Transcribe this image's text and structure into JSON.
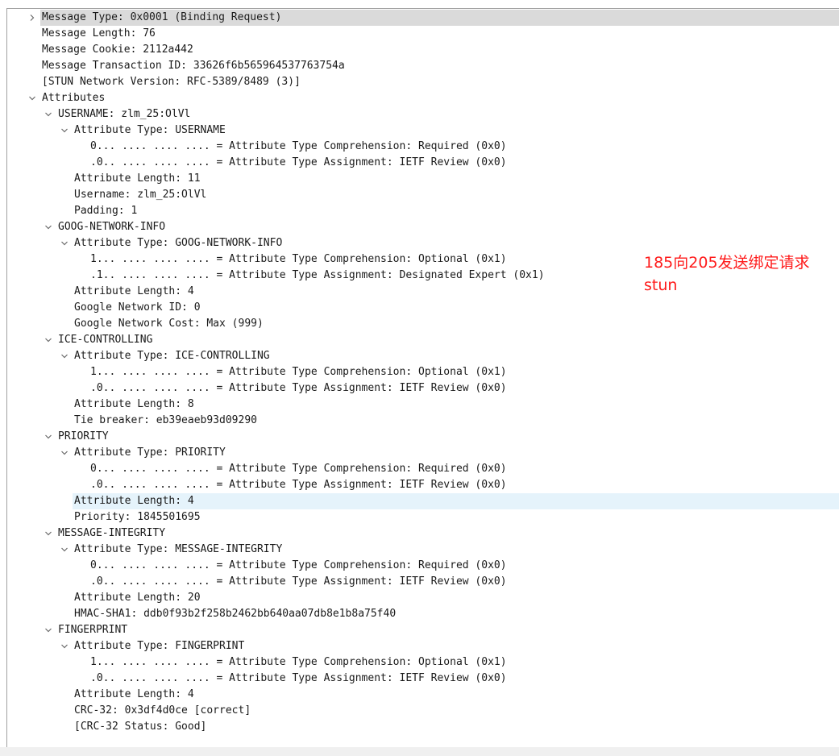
{
  "tree": [
    {
      "text": "Message Type: 0x0001 (Binding Request)",
      "level": 0,
      "toggle": "collapsed",
      "state": "selected",
      "name": "tree-item-message-type"
    },
    {
      "text": "Message Length: 76",
      "level": 0,
      "toggle": "none",
      "name": "tree-item-message-length"
    },
    {
      "text": "Message Cookie: 2112a442",
      "level": 0,
      "toggle": "none",
      "name": "tree-item-message-cookie"
    },
    {
      "text": "Message Transaction ID: 33626f6b565964537763754a",
      "level": 0,
      "toggle": "none",
      "name": "tree-item-transaction-id"
    },
    {
      "text": "[STUN Network Version: RFC-5389/8489 (3)]",
      "level": 0,
      "toggle": "none",
      "name": "tree-item-stun-network-version"
    },
    {
      "text": "Attributes",
      "level": 0,
      "toggle": "expanded",
      "name": "tree-item-attributes"
    },
    {
      "text": "USERNAME: zlm_25:OlVl",
      "level": 1,
      "toggle": "expanded",
      "name": "tree-item-attr-username"
    },
    {
      "text": "Attribute Type: USERNAME",
      "level": 2,
      "toggle": "expanded",
      "name": "tree-item-attribute-type"
    },
    {
      "text": "0... .... .... .... = Attribute Type Comprehension: Required (0x0)",
      "level": 3,
      "toggle": "none",
      "name": "tree-item-type-comprehension"
    },
    {
      "text": ".0.. .... .... .... = Attribute Type Assignment: IETF Review (0x0)",
      "level": 3,
      "toggle": "none",
      "name": "tree-item-type-assignment"
    },
    {
      "text": "Attribute Length: 11",
      "level": 2,
      "toggle": "none",
      "name": "tree-item-attribute-length"
    },
    {
      "text": "Username: zlm_25:OlVl",
      "level": 2,
      "toggle": "none",
      "name": "tree-item-username"
    },
    {
      "text": "Padding: 1",
      "level": 2,
      "toggle": "none",
      "name": "tree-item-padding"
    },
    {
      "text": "GOOG-NETWORK-INFO",
      "level": 1,
      "toggle": "expanded",
      "name": "tree-item-attr-goog-network-info"
    },
    {
      "text": "Attribute Type: GOOG-NETWORK-INFO",
      "level": 2,
      "toggle": "expanded",
      "name": "tree-item-attribute-type"
    },
    {
      "text": "1... .... .... .... = Attribute Type Comprehension: Optional (0x1)",
      "level": 3,
      "toggle": "none",
      "name": "tree-item-type-comprehension"
    },
    {
      "text": ".1.. .... .... .... = Attribute Type Assignment: Designated Expert (0x1)",
      "level": 3,
      "toggle": "none",
      "name": "tree-item-type-assignment"
    },
    {
      "text": "Attribute Length: 4",
      "level": 2,
      "toggle": "none",
      "name": "tree-item-attribute-length"
    },
    {
      "text": "Google Network ID: 0",
      "level": 2,
      "toggle": "none",
      "name": "tree-item-google-network-id"
    },
    {
      "text": "Google Network Cost: Max (999)",
      "level": 2,
      "toggle": "none",
      "name": "tree-item-google-network-cost"
    },
    {
      "text": "ICE-CONTROLLING",
      "level": 1,
      "toggle": "expanded",
      "name": "tree-item-attr-ice-controlling"
    },
    {
      "text": "Attribute Type: ICE-CONTROLLING",
      "level": 2,
      "toggle": "expanded",
      "name": "tree-item-attribute-type"
    },
    {
      "text": "1... .... .... .... = Attribute Type Comprehension: Optional (0x1)",
      "level": 3,
      "toggle": "none",
      "name": "tree-item-type-comprehension"
    },
    {
      "text": ".0.. .... .... .... = Attribute Type Assignment: IETF Review (0x0)",
      "level": 3,
      "toggle": "none",
      "name": "tree-item-type-assignment"
    },
    {
      "text": "Attribute Length: 8",
      "level": 2,
      "toggle": "none",
      "name": "tree-item-attribute-length"
    },
    {
      "text": "Tie breaker: eb39eaeb93d09290",
      "level": 2,
      "toggle": "none",
      "name": "tree-item-tie-breaker"
    },
    {
      "text": "PRIORITY",
      "level": 1,
      "toggle": "expanded",
      "name": "tree-item-attr-priority"
    },
    {
      "text": "Attribute Type: PRIORITY",
      "level": 2,
      "toggle": "expanded",
      "name": "tree-item-attribute-type"
    },
    {
      "text": "0... .... .... .... = Attribute Type Comprehension: Required (0x0)",
      "level": 3,
      "toggle": "none",
      "name": "tree-item-type-comprehension"
    },
    {
      "text": ".0.. .... .... .... = Attribute Type Assignment: IETF Review (0x0)",
      "level": 3,
      "toggle": "none",
      "name": "tree-item-type-assignment"
    },
    {
      "text": "Attribute Length: 4",
      "level": 2,
      "toggle": "none",
      "state": "hover",
      "name": "tree-item-attribute-length"
    },
    {
      "text": "Priority: 1845501695",
      "level": 2,
      "toggle": "none",
      "name": "tree-item-priority"
    },
    {
      "text": "MESSAGE-INTEGRITY",
      "level": 1,
      "toggle": "expanded",
      "name": "tree-item-attr-message-integrity"
    },
    {
      "text": "Attribute Type: MESSAGE-INTEGRITY",
      "level": 2,
      "toggle": "expanded",
      "name": "tree-item-attribute-type"
    },
    {
      "text": "0... .... .... .... = Attribute Type Comprehension: Required (0x0)",
      "level": 3,
      "toggle": "none",
      "name": "tree-item-type-comprehension"
    },
    {
      "text": ".0.. .... .... .... = Attribute Type Assignment: IETF Review (0x0)",
      "level": 3,
      "toggle": "none",
      "name": "tree-item-type-assignment"
    },
    {
      "text": "Attribute Length: 20",
      "level": 2,
      "toggle": "none",
      "name": "tree-item-attribute-length"
    },
    {
      "text": "HMAC-SHA1: ddb0f93b2f258b2462bb640aa07db8e1b8a75f40",
      "level": 2,
      "toggle": "none",
      "name": "tree-item-hmac-sha1"
    },
    {
      "text": "FINGERPRINT",
      "level": 1,
      "toggle": "expanded",
      "name": "tree-item-attr-fingerprint"
    },
    {
      "text": "Attribute Type: FINGERPRINT",
      "level": 2,
      "toggle": "expanded",
      "name": "tree-item-attribute-type"
    },
    {
      "text": "1... .... .... .... = Attribute Type Comprehension: Optional (0x1)",
      "level": 3,
      "toggle": "none",
      "name": "tree-item-type-comprehension"
    },
    {
      "text": ".0.. .... .... .... = Attribute Type Assignment: IETF Review (0x0)",
      "level": 3,
      "toggle": "none",
      "name": "tree-item-type-assignment"
    },
    {
      "text": "Attribute Length: 4",
      "level": 2,
      "toggle": "none",
      "name": "tree-item-attribute-length"
    },
    {
      "text": "CRC-32: 0x3df4d0ce [correct]",
      "level": 2,
      "toggle": "none",
      "name": "tree-item-crc32"
    },
    {
      "text": "[CRC-32 Status: Good]",
      "level": 2,
      "toggle": "none",
      "name": "tree-item-crc32-status"
    }
  ],
  "annotation": {
    "line1": "185向205发送绑定请求",
    "line2": "stun",
    "color": "#ff1a1a"
  },
  "colors": {
    "selected_row": "#dadada",
    "hover_row": "#e5f3fb",
    "text": "#1a1a1a",
    "chevron": "#6b6b6b"
  },
  "icons": {
    "collapsed": "chevron-right-icon",
    "expanded": "chevron-down-icon"
  }
}
